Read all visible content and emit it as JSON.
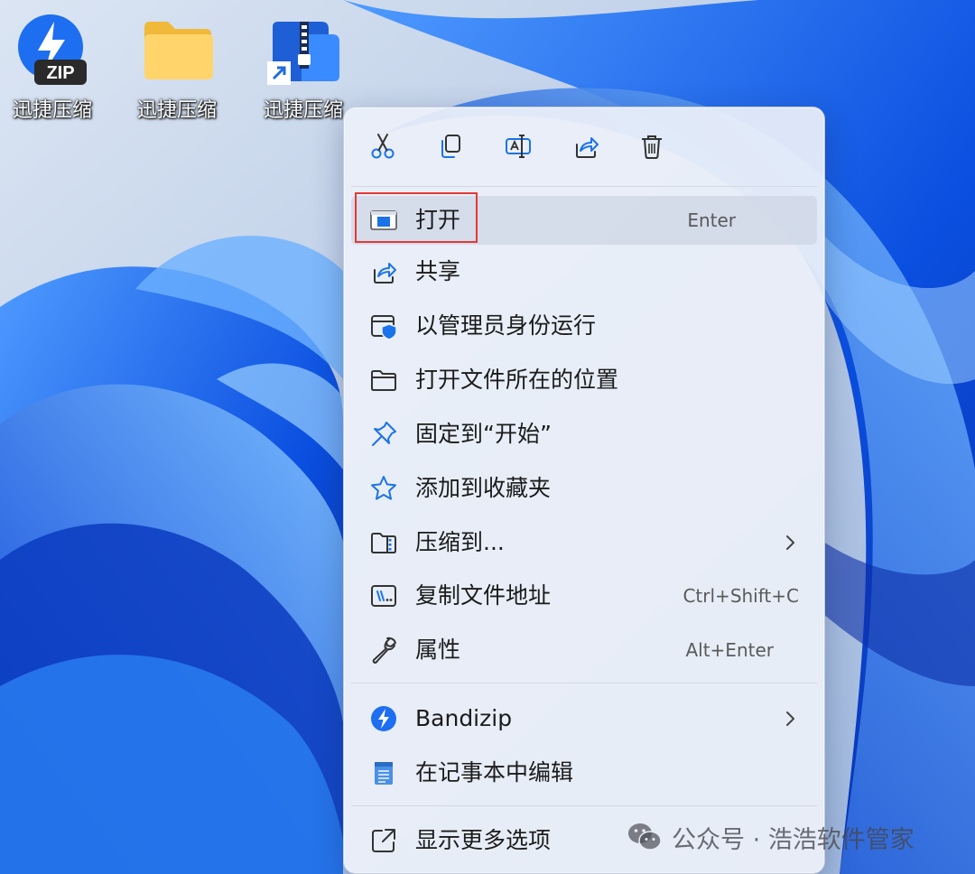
{
  "desktop": {
    "icons": [
      {
        "label": "迅捷压缩",
        "badge": "ZIP"
      },
      {
        "label": "迅捷压缩"
      },
      {
        "label": "迅捷压缩"
      }
    ]
  },
  "context_menu": {
    "toolbar": [
      {
        "icon": "cut-icon",
        "tooltip": ""
      },
      {
        "icon": "copy-icon"
      },
      {
        "icon": "rename-icon"
      },
      {
        "icon": "share-icon"
      },
      {
        "icon": "delete-icon"
      }
    ],
    "items": [
      {
        "label": "打开",
        "shortcut": "Enter",
        "icon": "open-app-icon",
        "highlighted": true
      },
      {
        "label": "共享",
        "shortcut": "",
        "icon": "share-icon"
      },
      {
        "label": "以管理员身份运行",
        "shortcut": "",
        "icon": "run-as-admin-icon"
      },
      {
        "label": "打开文件所在的位置",
        "shortcut": "",
        "icon": "folder-icon"
      },
      {
        "label": "固定到“开始”",
        "shortcut": "",
        "icon": "pin-icon"
      },
      {
        "label": "添加到收藏夹",
        "shortcut": "",
        "icon": "star-icon"
      },
      {
        "label": "压缩到...",
        "shortcut": "",
        "icon": "zip-folder-icon",
        "submenu": true
      },
      {
        "label": "复制文件地址",
        "shortcut": "Ctrl+Shift+C",
        "icon": "copy-path-icon"
      },
      {
        "label": "属性",
        "shortcut": "Alt+Enter",
        "icon": "wrench-icon"
      }
    ],
    "extra_items": [
      {
        "label": "Bandizip",
        "icon": "bandizip-icon",
        "submenu": true
      },
      {
        "label": "在记事本中编辑",
        "icon": "notepad-icon"
      }
    ],
    "footer_item": {
      "label": "显示更多选项",
      "icon": "show-more-icon"
    }
  },
  "watermark": {
    "text": "公众号 · 浩浩软件管家"
  },
  "colors": {
    "accent": "#1a73e8",
    "highlight_border": "#e53935",
    "menu_bg": "#ecf0f9"
  }
}
